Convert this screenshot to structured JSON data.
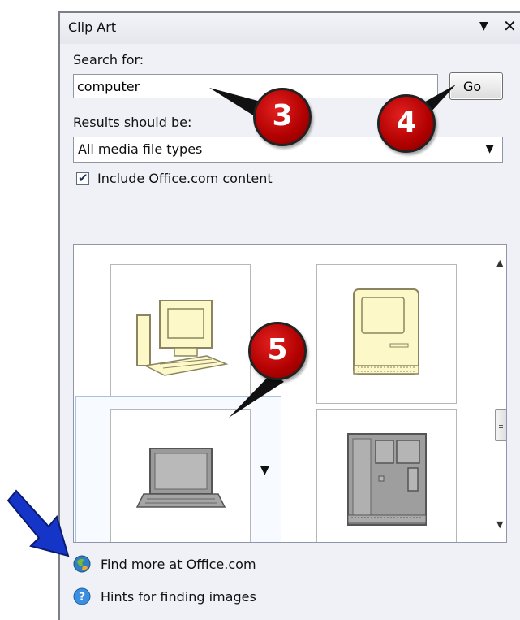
{
  "pane": {
    "title": "Clip Art",
    "menu_icon": "chevron-down-icon",
    "close_icon": "close-icon"
  },
  "search": {
    "label": "Search for:",
    "value": "computer",
    "go_label": "Go"
  },
  "results_type": {
    "label": "Results should be:",
    "selected": "All media file types"
  },
  "include": {
    "label": "Include Office.com content",
    "checked": true
  },
  "results": {
    "items": [
      {
        "name": "desktop-computer-clipart"
      },
      {
        "name": "classic-mac-clipart"
      },
      {
        "name": "laptop-clipart"
      },
      {
        "name": "computer-tower-clipart"
      }
    ]
  },
  "links": {
    "find_more": "Find more at Office.com",
    "hints": "Hints for finding images"
  },
  "callouts": {
    "step3": "3",
    "step4": "4",
    "step5": "5"
  },
  "colors": {
    "callout_red": "#c00000",
    "clipart_yellow": "#fdf8c8",
    "arrow_blue": "#1535c8"
  }
}
